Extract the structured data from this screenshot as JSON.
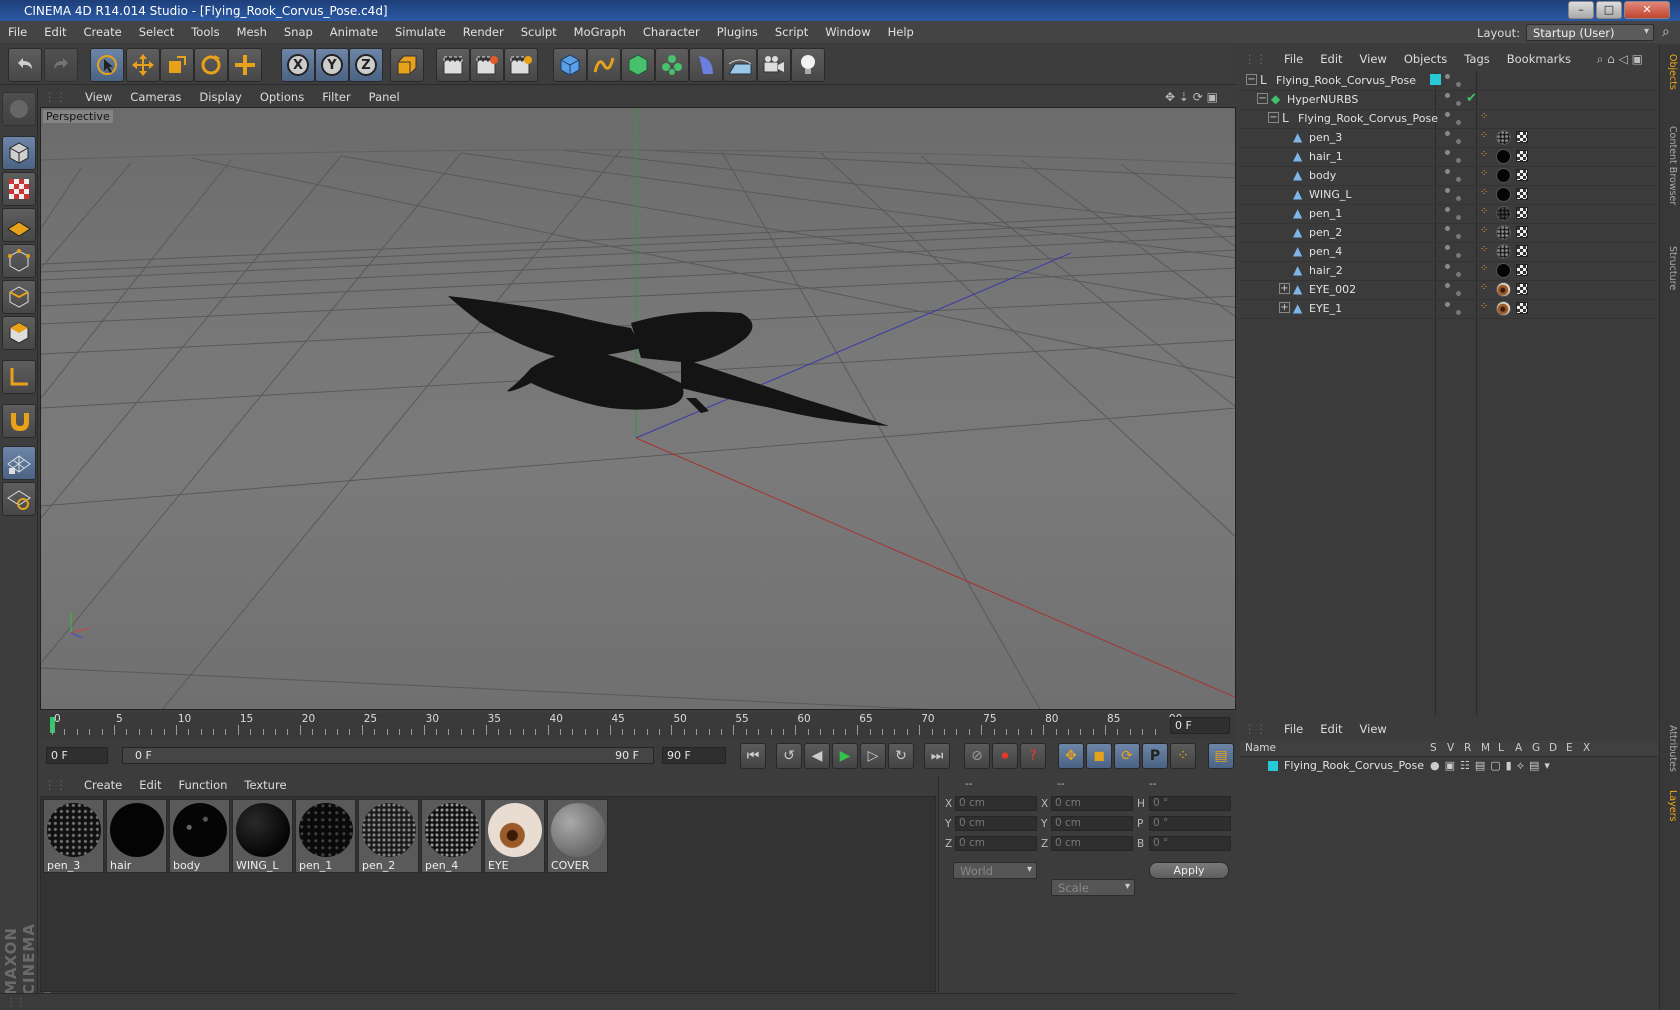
{
  "window": {
    "title": "CINEMA 4D R14.014 Studio - [Flying_Rook_Corvus_Pose.c4d]",
    "min_label": "–",
    "max_label": "□",
    "close_label": "✕"
  },
  "menubar": {
    "items": [
      "File",
      "Edit",
      "Create",
      "Select",
      "Tools",
      "Mesh",
      "Snap",
      "Animate",
      "Simulate",
      "Render",
      "Sculpt",
      "MoGraph",
      "Character",
      "Plugins",
      "Script",
      "Window",
      "Help"
    ],
    "layout_label": "Layout:",
    "layout_value": "Startup (User)"
  },
  "viewport": {
    "menu": [
      "View",
      "Cameras",
      "Display",
      "Options",
      "Filter",
      "Panel"
    ],
    "camera_label": "Perspective"
  },
  "timeline": {
    "ticks": [
      "0",
      "5",
      "10",
      "15",
      "20",
      "25",
      "30",
      "35",
      "40",
      "45",
      "50",
      "55",
      "60",
      "65",
      "70",
      "75",
      "80",
      "85",
      "90"
    ],
    "end_field": "0 F",
    "current_frame": "0 F",
    "range_start": "0 F",
    "range_end": "90 F",
    "max_frame": "90 F"
  },
  "materials": {
    "menu": [
      "Create",
      "Edit",
      "Function",
      "Texture"
    ],
    "items": [
      {
        "label": "pen_3",
        "style": "speckle"
      },
      {
        "label": "hair",
        "style": "black"
      },
      {
        "label": "body",
        "style": "black-dots"
      },
      {
        "label": "WING_L",
        "style": "dark"
      },
      {
        "label": "pen_1",
        "style": "dark-speckle"
      },
      {
        "label": "pen_2",
        "style": "speckle"
      },
      {
        "label": "pen_4",
        "style": "speckle"
      },
      {
        "label": "EYE",
        "style": "eye"
      },
      {
        "label": "COVER",
        "style": "grey"
      }
    ]
  },
  "coords": {
    "headers": [
      "--",
      "--",
      "--"
    ],
    "rows": [
      {
        "a": "X",
        "av": "0 cm",
        "b": "X",
        "bv": "0 cm",
        "c": "H",
        "cv": "0 °"
      },
      {
        "a": "Y",
        "av": "0 cm",
        "b": "Y",
        "bv": "0 cm",
        "c": "P",
        "cv": "0 °"
      },
      {
        "a": "Z",
        "av": "0 cm",
        "b": "Z",
        "bv": "0 cm",
        "c": "B",
        "cv": "0 °"
      }
    ],
    "world": "World",
    "scale": "Scale",
    "apply": "Apply"
  },
  "objects": {
    "menu": [
      "File",
      "Edit",
      "View",
      "Objects",
      "Tags",
      "Bookmarks"
    ],
    "rows": [
      {
        "name": "Flying_Rook_Corvus_Pose",
        "type": "null",
        "expand": "−"
      },
      {
        "name": "HyperNURBS",
        "type": "nurbs",
        "expand": "−"
      },
      {
        "name": "Flying_Rook_Corvus_Pose",
        "type": "null",
        "expand": "−"
      },
      {
        "name": "pen_3",
        "type": "poly",
        "expand": ""
      },
      {
        "name": "hair_1",
        "type": "poly",
        "expand": ""
      },
      {
        "name": "body",
        "type": "poly",
        "expand": ""
      },
      {
        "name": "WING_L",
        "type": "poly",
        "expand": ""
      },
      {
        "name": "pen_1",
        "type": "poly",
        "expand": ""
      },
      {
        "name": "pen_2",
        "type": "poly",
        "expand": ""
      },
      {
        "name": "pen_4",
        "type": "poly",
        "expand": ""
      },
      {
        "name": "hair_2",
        "type": "poly",
        "expand": ""
      },
      {
        "name": "EYE_002",
        "type": "poly",
        "expand": "+"
      },
      {
        "name": "EYE_1",
        "type": "poly",
        "expand": "+"
      }
    ],
    "checkmark": "✔"
  },
  "layers": {
    "menu": [
      "File",
      "Edit",
      "View"
    ],
    "header_name": "Name",
    "flags": [
      "S",
      "V",
      "R",
      "M",
      "L",
      "A",
      "G",
      "D",
      "E",
      "X"
    ],
    "rows": [
      {
        "name": "Flying_Rook_Corvus_Pose"
      }
    ]
  },
  "right_tabs": [
    "Objects",
    "Content Browser",
    "Structure",
    "Attributes",
    "Layers"
  ],
  "branding": "MAXON CINEMA 4D"
}
